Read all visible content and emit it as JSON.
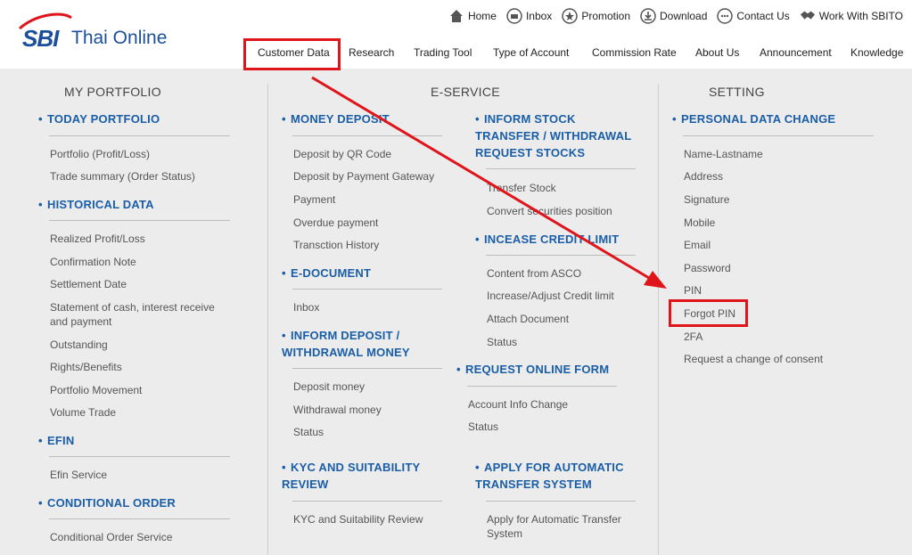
{
  "brand": {
    "logo_mark": "SBI",
    "logo_text": "Thai Online"
  },
  "top_nav": [
    {
      "label": "Home",
      "icon": "home-icon"
    },
    {
      "label": "Inbox",
      "icon": "inbox-icon"
    },
    {
      "label": "Promotion",
      "icon": "star-icon"
    },
    {
      "label": "Download",
      "icon": "download-icon"
    },
    {
      "label": "Contact Us",
      "icon": "chat-icon"
    },
    {
      "label": "Work With SBITO",
      "icon": "handshake-icon"
    }
  ],
  "main_nav": [
    "Customer Data",
    "Research",
    "Trading Tool",
    "Type of Account",
    "Commission Rate",
    "About Us",
    "Announcement",
    "Knowledge"
  ],
  "columns": {
    "portfolio": {
      "title": "MY PORTFOLIO",
      "sections": [
        {
          "title": "TODAY PORTFOLIO",
          "items": [
            "Portfolio (Profit/Loss)",
            "Trade summary (Order Status)"
          ]
        },
        {
          "title": "HISTORICAL DATA",
          "items": [
            "Realized Profit/Loss",
            "Confirmation Note",
            "Settlement Date",
            "Statement of cash, interest receive and payment",
            "Outstanding",
            "Rights/Benefits",
            "Portfolio Movement",
            "Volume Trade"
          ]
        },
        {
          "title": "EFIN",
          "items": [
            "Efin Service"
          ]
        },
        {
          "title": "CONDITIONAL ORDER",
          "items": [
            "Conditional Order Service"
          ]
        }
      ]
    },
    "eservice": {
      "title": "E-SERVICE",
      "left_sections": [
        {
          "title": "MONEY DEPOSIT",
          "items": [
            "Deposit by QR Code",
            "Deposit by Payment Gateway",
            "Payment",
            "Overdue payment",
            "Transction History"
          ]
        },
        {
          "title": "E-DOCUMENT",
          "items": [
            "Inbox"
          ]
        },
        {
          "title": "INFORM DEPOSIT / WITHDRAWAL MONEY",
          "items": [
            "Deposit money",
            "Withdrawal money",
            "Status"
          ]
        },
        {
          "title": "KYC AND SUITABILITY REVIEW",
          "items": [
            "KYC and Suitability Review"
          ]
        }
      ],
      "right_sections": [
        {
          "title": "INFORM STOCK TRANSFER / WITHDRAWAL REQUEST STOCKS",
          "items": [
            "Transfer Stock",
            "Convert securities position"
          ]
        },
        {
          "title": "INCEASE CREDIT LIMIT",
          "items": [
            "Content from ASCO",
            "Increase/Adjust Credit limit",
            "Attach Document",
            "Status"
          ]
        },
        {
          "title": "REQUEST ONLINE FORM",
          "items": [
            "Account Info Change",
            "Status"
          ]
        },
        {
          "title": "APPLY FOR AUTOMATIC TRANSFER SYSTEM",
          "items": [
            "Apply for Automatic Transfer System"
          ]
        }
      ]
    },
    "setting": {
      "title": "SETTING",
      "sections": [
        {
          "title": "PERSONAL DATA CHANGE",
          "items": [
            "Name-Lastname",
            "Address",
            "Signature",
            "Mobile",
            "Email",
            "Password",
            "PIN",
            "Forgot PIN",
            "2FA",
            "Request a change of consent"
          ]
        }
      ]
    }
  },
  "colors": {
    "link_blue": "#1a5ea8",
    "highlight_red": "#e0141b",
    "brand_blue": "#1b4f9b",
    "brand_red": "#e0141b"
  }
}
